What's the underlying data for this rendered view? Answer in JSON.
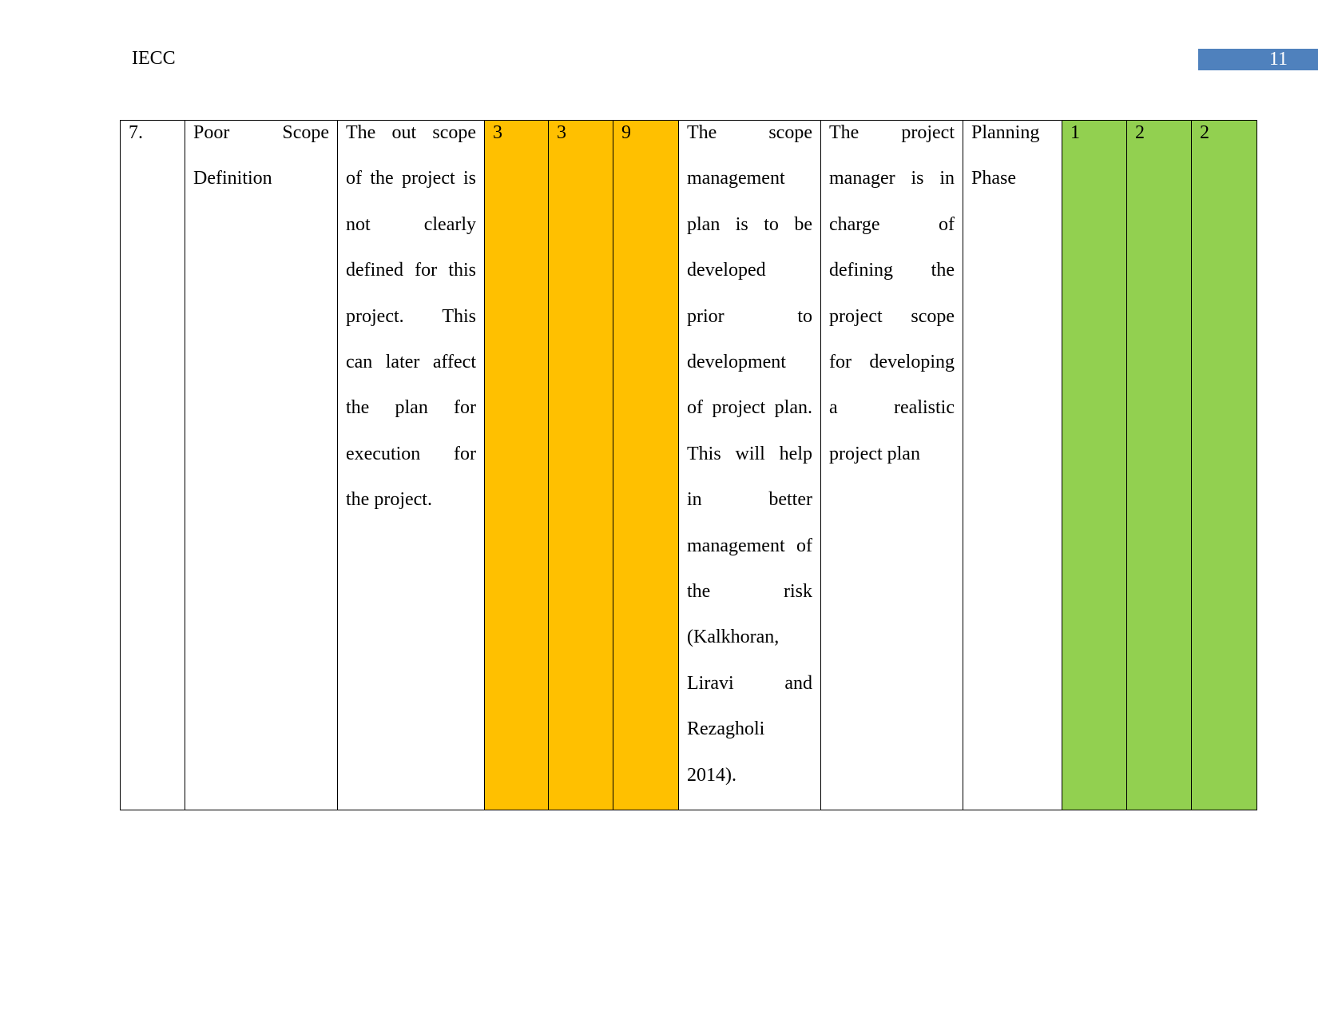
{
  "header": {
    "title": "IECC",
    "page_number": "11"
  },
  "colors": {
    "risk_before": "#FFC000",
    "risk_after": "#92D050",
    "page_badge": "#4F81BD"
  },
  "row": {
    "number": "7.",
    "risk": [
      "Poor Scope",
      "Definition"
    ],
    "description": [
      "The out scope",
      "of the project is",
      "not clearly",
      "defined for this",
      "project. This",
      "can later affect",
      "the plan for",
      "execution for",
      "the project."
    ],
    "likelihood": "3",
    "impact": "3",
    "score": "9",
    "mitigation": [
      "The scope",
      "management",
      "plan is to be",
      "developed",
      "prior to",
      "development",
      "of project plan.",
      "This will help",
      "in better",
      "management of",
      "the risk",
      "(Kalkhoran,",
      "Liravi and",
      "Rezagholi",
      "2014)."
    ],
    "owner": [
      "The project",
      "manager is in",
      "charge of",
      "defining the",
      "project scope",
      "for developing",
      "a realistic",
      "project plan"
    ],
    "phase": [
      "Planning",
      "Phase"
    ],
    "residual_likelihood": "1",
    "residual_impact": "2",
    "residual_score": "2"
  }
}
